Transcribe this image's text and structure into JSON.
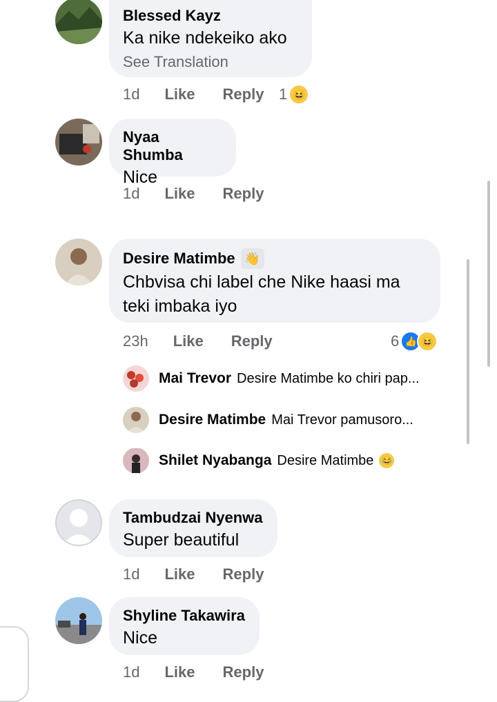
{
  "comments": [
    {
      "author": "Blessed Kayz",
      "text": "Ka nike ndekeiko ako",
      "translation_link": "See Translation",
      "time": "1d",
      "like": "Like",
      "reply": "Reply",
      "reaction_count": "1",
      "reaction_icon": "laughing-emoji-icon"
    },
    {
      "author": "Nyaa Shumba",
      "text": "Nice",
      "time": "1d",
      "like": "Like",
      "reply": "Reply"
    },
    {
      "author": "Desire Matimbe",
      "author_badge_icon": "waving-hand-icon",
      "text_line1": "Chbvisa chi label che Nike haasi ma",
      "text_line2": "teki imbaka iyo",
      "time": "23h",
      "like": "Like",
      "reply": "Reply",
      "reaction_count": "6",
      "reaction_icons": [
        "like-icon",
        "laughing-emoji-icon"
      ],
      "replies": [
        {
          "author": "Mai Trevor",
          "text": "Desire Matimbe ko chiri pap..."
        },
        {
          "author": "Desire Matimbe",
          "text": "Mai Trevor pamusoro..."
        },
        {
          "author": "Shilet Nyabanga",
          "text": "Desire Matimbe",
          "emoji": "laughing-tears-icon"
        }
      ]
    },
    {
      "author": "Tambudzai Nyenwa",
      "text": "Super beautiful",
      "time": "1d",
      "like": "Like",
      "reply": "Reply"
    },
    {
      "author": "Shyline Takawira",
      "text": "Nice",
      "time": "1d",
      "like": "Like",
      "reply": "Reply"
    }
  ]
}
